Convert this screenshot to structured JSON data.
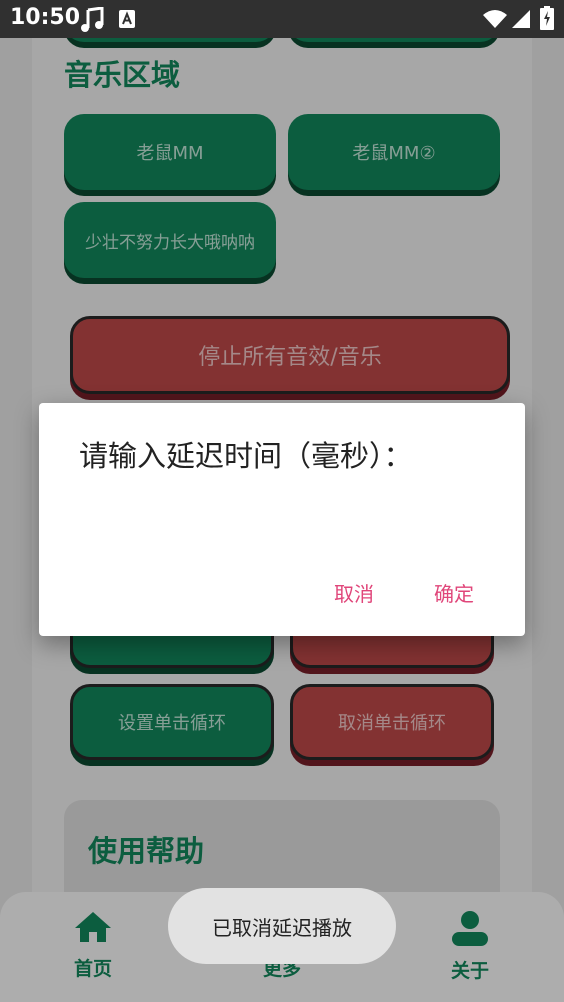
{
  "status_bar": {
    "time": "10:50",
    "icons": [
      "music-note-icon",
      "text-a-icon",
      "wifi-icon",
      "signal-icon",
      "battery-icon"
    ]
  },
  "music_section": {
    "title": "音乐区域",
    "buttons": [
      {
        "label": "老鼠MM"
      },
      {
        "label": "老鼠MM②"
      },
      {
        "label": "少壮不努力长大哦呐呐"
      }
    ],
    "stop_all": "停止所有音效/音乐"
  },
  "loop_controls": {
    "set_click_loop": "设置单击循环",
    "cancel_click_loop": "取消单击循环"
  },
  "help_section": {
    "title": "使用帮助"
  },
  "bottom_nav": {
    "items": [
      {
        "label": "首页",
        "icon": "home-icon"
      },
      {
        "label": "更多",
        "icon": "more-icon"
      },
      {
        "label": "关于",
        "icon": "person-icon"
      }
    ]
  },
  "dialog": {
    "title": "请输入延迟时间（毫秒）：",
    "cancel": "取消",
    "confirm": "确定"
  },
  "toast": {
    "message": "已取消延迟播放"
  },
  "colors": {
    "primary_green": "#138a5e",
    "danger_red": "#c24a4a",
    "accent_pink": "#e0467a"
  }
}
